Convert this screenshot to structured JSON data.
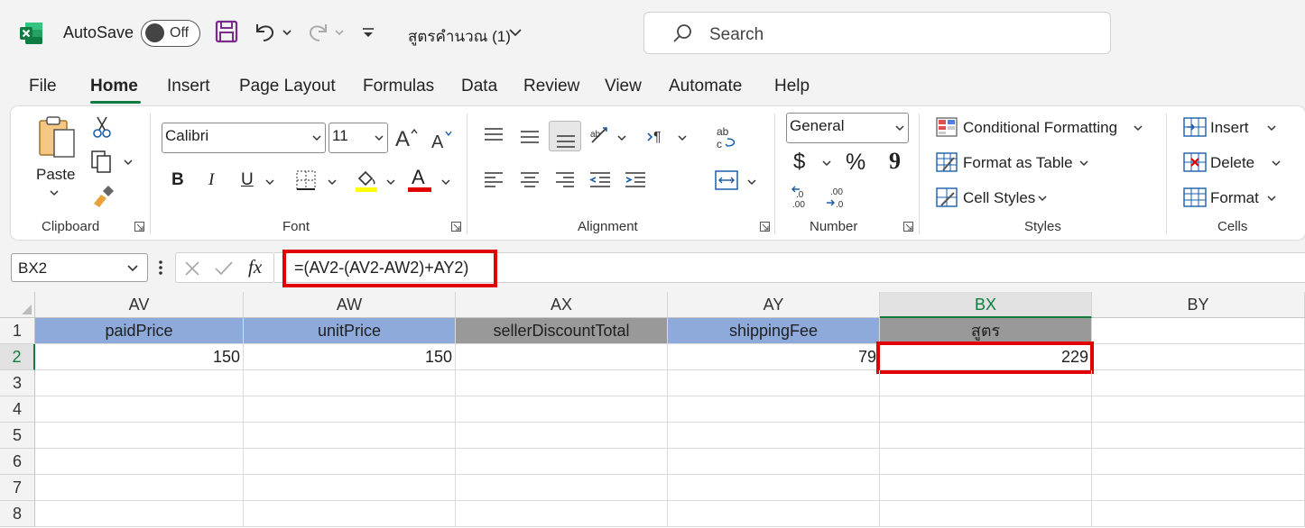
{
  "titlebar": {
    "autosave_label": "AutoSave",
    "autosave_state": "Off",
    "doc_title": "สูตรคำนวณ (1)",
    "search_placeholder": "Search"
  },
  "tabs": [
    "File",
    "Home",
    "Insert",
    "Page Layout",
    "Formulas",
    "Data",
    "Review",
    "View",
    "Automate",
    "Help"
  ],
  "active_tab": "Home",
  "ribbon": {
    "clipboard": {
      "paste": "Paste",
      "label": "Clipboard"
    },
    "font": {
      "name": "Calibri",
      "size": "11",
      "label": "Font",
      "bold": "B",
      "italic": "I",
      "underline": "U",
      "font_color_glyph": "A"
    },
    "alignment": {
      "label": "Alignment"
    },
    "number": {
      "format": "General",
      "currency": "$",
      "percent": "%",
      "comma": "9",
      "label": "Number"
    },
    "styles": {
      "conditional": "Conditional Formatting",
      "format_table": "Format as Table",
      "cell_styles": "Cell Styles",
      "label": "Styles"
    },
    "cells": {
      "insert": "Insert",
      "delete": "Delete",
      "format": "Format",
      "label": "Cells"
    }
  },
  "formula_bar": {
    "name_box": "BX2",
    "fx": "fx",
    "formula": "=(AV2-(AV2-AW2)+AY2)"
  },
  "sheet": {
    "columns": [
      "AV",
      "AW",
      "AX",
      "AY",
      "BX",
      "BY"
    ],
    "selected_column": "BX",
    "rows": [
      "1",
      "2",
      "3",
      "4",
      "5",
      "6",
      "7",
      "8"
    ],
    "selected_row": "2",
    "header_row": [
      "paidPrice",
      "unitPrice",
      "sellerDiscountTotal",
      "shippingFee",
      "สูตร",
      ""
    ],
    "data_row": [
      "150",
      "150",
      "",
      "79",
      "229",
      ""
    ]
  },
  "colors": {
    "excel_green": "#107c41",
    "header_blue": "#8eaadb",
    "header_gray": "#999999",
    "highlight_red": "#e00000"
  }
}
